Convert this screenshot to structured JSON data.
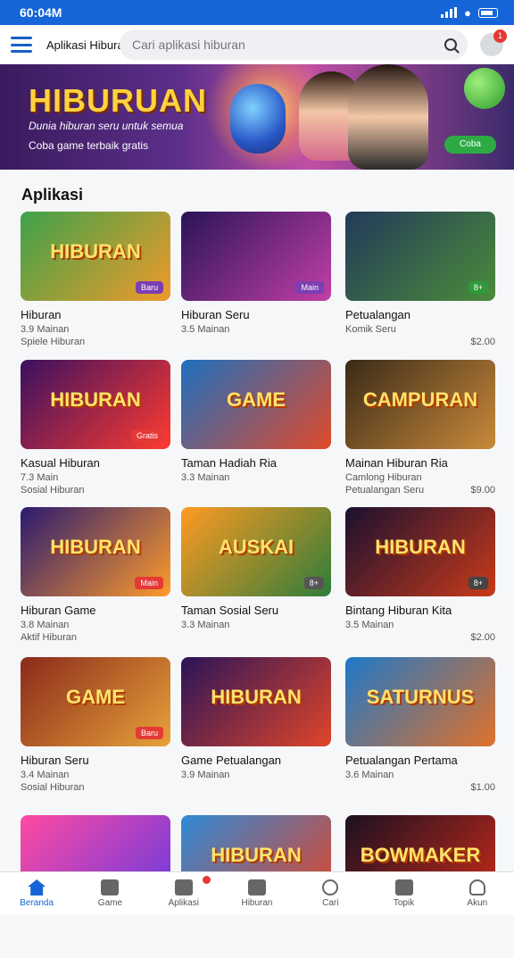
{
  "status": {
    "time": "60:04M"
  },
  "header": {
    "app_name": "Aplikasi Hiburan",
    "search_placeholder": "Cari aplikasi hiburan",
    "notif_count": "1"
  },
  "banner": {
    "title": "HIBURUAN",
    "subtitle": "Dunia hiburan seru untuk semua",
    "subtitle2": "Coba game terbaik gratis",
    "cta": "Coba"
  },
  "section": {
    "title": "Aplikasi"
  },
  "cards": [
    {
      "thumb_text": "HIBURAN",
      "badge": "Baru",
      "title": "Hiburan",
      "meta": "3.9 Mainan",
      "meta2": "Spiele Hiburan",
      "price": "",
      "c1": "#3ea24a",
      "c2": "#f09a2a",
      "badgeColor": "#7b3fb2"
    },
    {
      "thumb_text": "",
      "badge": "Main",
      "title": "Hiburan Seru",
      "meta": "3.5 Mainan",
      "meta2": "",
      "price": "",
      "c1": "#2a1458",
      "c2": "#c13fa6",
      "badgeColor": "#7b3fb2"
    },
    {
      "thumb_text": "",
      "badge": "8+",
      "title": "Petualangan",
      "meta": "Komik Seru",
      "meta2": "",
      "price": "$2.00",
      "c1": "#233a5a",
      "c2": "#4a8c3a",
      "badgeColor": "#2e9a3a"
    },
    {
      "thumb_text": "HIBURAN",
      "badge": "Gratis",
      "title": "Kasual Hiburan",
      "meta": "7.3 Main",
      "meta2": "Sosial Hiburan",
      "price": "",
      "c1": "#3a1060",
      "c2": "#ff3b2f",
      "badgeColor": "#e53935"
    },
    {
      "thumb_text": "GAME",
      "badge": "",
      "title": "Taman Hadiah Ria",
      "meta": "3.3 Mainan",
      "meta2": "",
      "price": "",
      "c1": "#1e6fc0",
      "c2": "#e04a2a",
      "badgeColor": "#1e6fc0"
    },
    {
      "thumb_text": "CAMPURAN",
      "badge": "",
      "title": "Mainan Hiburan Ria",
      "meta": "Camlong Hiburan",
      "meta2": "Petualangan Seru",
      "price": "$9.00",
      "c1": "#3a2a18",
      "c2": "#c98a3a",
      "badgeColor": "#555"
    },
    {
      "thumb_text": "HIBURAN",
      "badge": "Main",
      "title": "Hiburan Game",
      "meta": "3.8 Mainan",
      "meta2": "Aktif Hiburan",
      "price": "",
      "c1": "#2a1a70",
      "c2": "#ff9b2a",
      "badgeColor": "#e53935"
    },
    {
      "thumb_text": "AUSKAI",
      "badge": "8+",
      "title": "Taman Sosial Seru",
      "meta": "3.3 Mainan",
      "meta2": "",
      "price": "",
      "c1": "#ff9a22",
      "c2": "#2e7d3a",
      "badgeColor": "#555"
    },
    {
      "thumb_text": "HIBURAN",
      "badge": "8+",
      "title": "Bintang Hiburan Kita",
      "meta": "3.5 Mainan",
      "meta2": "",
      "price": "$2.00",
      "c1": "#1a1030",
      "c2": "#c93a1a",
      "badgeColor": "#444"
    },
    {
      "thumb_text": "GAME",
      "badge": "Baru",
      "title": "Hiburan Seru",
      "meta": "3.4 Mainan",
      "meta2": "Sosial Hiburan",
      "price": "",
      "c1": "#8a2a1a",
      "c2": "#e8a23a",
      "badgeColor": "#e53935"
    },
    {
      "thumb_text": "HIBURAN",
      "badge": "",
      "title": "Game Petualangan",
      "meta": "3.9 Mainan",
      "meta2": "",
      "price": "",
      "c1": "#2a1458",
      "c2": "#e0452a",
      "badgeColor": "#555"
    },
    {
      "thumb_text": "SATURNUS",
      "badge": "",
      "title": "Petualangan Pertama",
      "meta": "3.6 Mainan",
      "meta2": "",
      "price": "$1.00",
      "c1": "#1e78c8",
      "c2": "#e0712a",
      "badgeColor": "#555"
    },
    {
      "thumb_text": "",
      "badge": "",
      "title": "",
      "meta": "",
      "meta2": "",
      "price": "",
      "c1": "#ff4aa0",
      "c2": "#6a3ae0",
      "badgeColor": "#555"
    },
    {
      "thumb_text": "HIBURAN",
      "badge": "",
      "title": "",
      "meta": "",
      "meta2": "",
      "price": "",
      "c1": "#2e8ad8",
      "c2": "#e0452a",
      "badgeColor": "#555"
    },
    {
      "thumb_text": "BOWMAKER",
      "badge": "",
      "title": "",
      "meta": "",
      "meta2": "",
      "price": "",
      "c1": "#1a1020",
      "c2": "#c92a1a",
      "badgeColor": "#555"
    }
  ],
  "nav": [
    {
      "label": "Beranda"
    },
    {
      "label": "Game"
    },
    {
      "label": "Aplikasi"
    },
    {
      "label": "Hiburan"
    },
    {
      "label": "Cari"
    },
    {
      "label": "Topik"
    },
    {
      "label": "Akun"
    }
  ]
}
